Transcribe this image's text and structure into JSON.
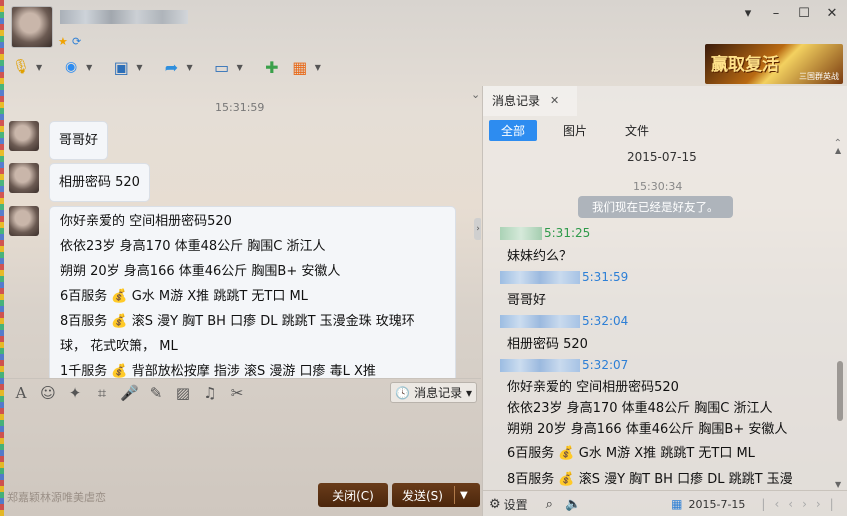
{
  "window": {
    "buttons": [
      "▾",
      "–",
      "☐",
      "✕"
    ]
  },
  "toolbar": {
    "items": [
      "microphone",
      "webcam",
      "screen-share",
      "file-transfer",
      "remote-assist",
      "add-chat",
      "apps"
    ]
  },
  "banner": {
    "title": "赢取复活",
    "subtitle": "三国群英战"
  },
  "chat": {
    "time": "15:31:59",
    "messages": [
      "哥哥好",
      "相册密码 520"
    ],
    "long_message": [
      "你好亲爱的  空间相册密码520",
      "依依23岁 身高170 体重48公斤 胸围C  浙江人",
      "朔朔 20岁 身高166 体重46公斤 胸围B+  安徽人",
      "6百服务 💰 G水 M游 X推 跳跳T 无T口 ML",
      "8百服务 💰 滚S 漫Y 胸T  BH  口瘆 DL  跳跳T   玉漫金珠 玫瑰环",
      "球， 花式吹箫，  ML",
      "1千服务 💰 背部放松按摩   指涉   滚S   漫游   口瘆   毒L   X推"
    ]
  },
  "input_toolbar": {
    "history_label": "消息记录"
  },
  "footer": {
    "left_text": "郑嘉颖林源唯美虐恋",
    "close_label": "关闭(C)",
    "send_label": "发送(S)"
  },
  "history": {
    "tab_label": "消息记录",
    "tab_close": "✕",
    "filters": [
      "全部",
      "图片",
      "文件"
    ],
    "date": "2015-07-15",
    "time_sep": "15:30:34",
    "notice": "我们现在已经是好友了。",
    "entries": [
      {
        "time": "5:31:25",
        "text": "妹妹约么？",
        "color": "green"
      },
      {
        "time": "5:31:59",
        "text": "哥哥好",
        "color": "blue"
      },
      {
        "time": "5:32:04",
        "text": "相册密码 520",
        "color": "blue"
      },
      {
        "time": "5:32:07",
        "text": "",
        "color": "blue"
      }
    ],
    "last_lines": [
      "你好亲爱的  空间相册密码520",
      "依依23岁 身高170 体重48公斤 胸围C  浙江人",
      "朔朔 20岁 身高166 体重46公斤 胸围B+  安徽人",
      "6百服务 💰 G水 M游 X推 跳跳T 无T口 ML",
      "8百服务 💰 滚S 漫Y 胸T  BH  口瘆 DL  跳跳T   玉漫"
    ],
    "settings_label": "设置",
    "bottom_date": "2015-7-15"
  },
  "colors": {
    "accent": "#2d8cf0",
    "button_brown": "#4b260c",
    "link_blue": "#2d7fd6",
    "green_time": "#2e9a4a"
  }
}
